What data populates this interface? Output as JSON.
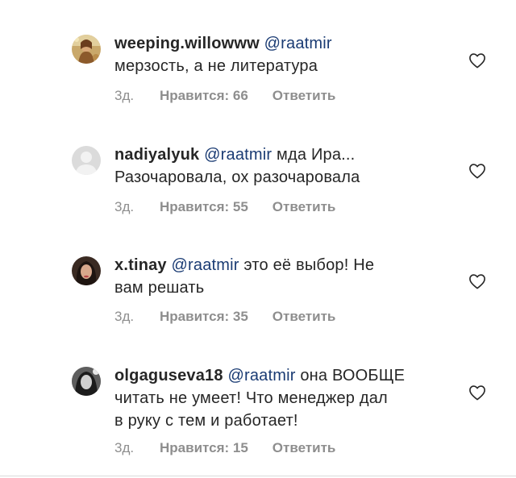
{
  "comments": [
    {
      "username": "weeping.willowww",
      "mention": "@raatmir",
      "text_line1": "",
      "text_line2": "мерзость, а не литература",
      "text_line3": "",
      "time": "3д.",
      "likes": "Нравится: 66",
      "reply": "Ответить",
      "avatar": "photo-avatar-gold"
    },
    {
      "username": "nadiyalyuk",
      "mention": "@raatmir",
      "text_line1": " мда Ира...",
      "text_line2": "Разочаровала, ох разочаровала",
      "text_line3": "",
      "time": "3д.",
      "likes": "Нравится: 55",
      "reply": "Ответить",
      "avatar": "default-avatar"
    },
    {
      "username": "x.tinay",
      "mention": "@raatmir",
      "text_line1": " это её выбор! Не",
      "text_line2": "вам решать",
      "text_line3": "",
      "time": "3д.",
      "likes": "Нравится: 35",
      "reply": "Ответить",
      "avatar": "photo-avatar-dark-hair"
    },
    {
      "username": "olgaguseva18",
      "mention": "@raatmir",
      "text_line1": " она ВООБЩЕ",
      "text_line2": "читать не умеет! Что менеджер дал",
      "text_line3": "в руку с тем и работает!",
      "time": "3д.",
      "likes": "Нравится: 15",
      "reply": "Ответить",
      "avatar": "photo-avatar-bw"
    }
  ],
  "colors": {
    "text": "#262626",
    "mention": "#1a3b73",
    "meta": "#8e8e8e"
  }
}
